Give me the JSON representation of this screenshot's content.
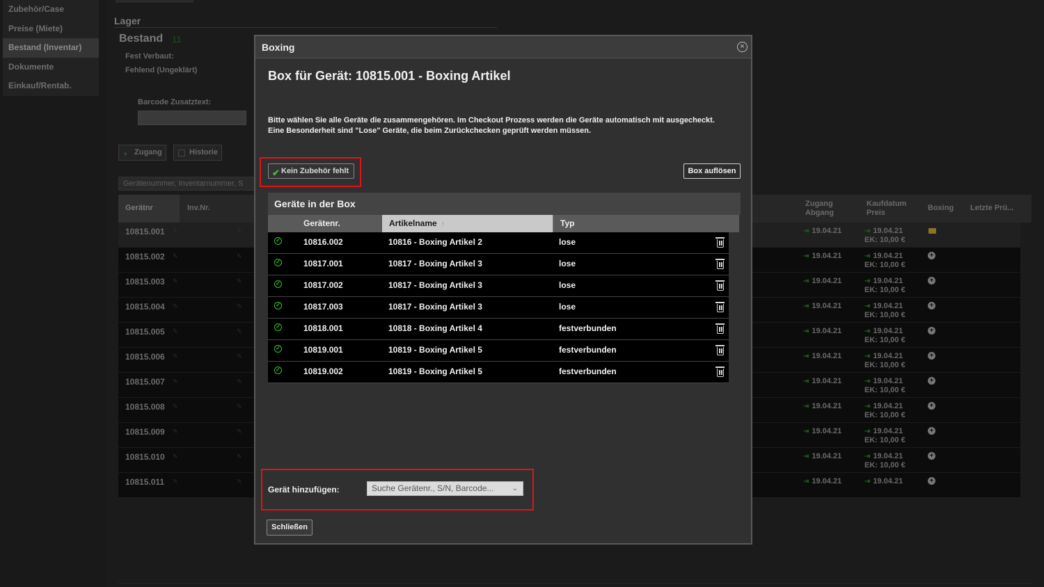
{
  "sidebar": {
    "items": [
      {
        "label": "Zubehör/Case",
        "active": false
      },
      {
        "label": "Preise (Miete)",
        "active": false
      },
      {
        "label": "Bestand (Inventar)",
        "active": true
      },
      {
        "label": "Dokumente",
        "active": false
      },
      {
        "label": "Einkauf/Rentab.",
        "active": false
      }
    ]
  },
  "main": {
    "section_title": "Lager",
    "bestand_title": "Bestand",
    "bestand_count": "11",
    "fest_verbaut_label": "Fest Verbaut:",
    "fehlend_label": "Fehlend (Ungeklärt)",
    "barcode_label": "Barcode Zusatztext:",
    "zugang_button": "Zugang",
    "historie_button": "Historie",
    "search_placeholder": "Gerätenummer, Inventarnummer, S",
    "table_headers": {
      "geraetnr": "Gerätnr",
      "inv_nr": "Inv.Nr.",
      "zugang_1": "Zugang",
      "zugang_2": "Abgang",
      "kaufdatum_1": "Kaufdatum",
      "kaufdatum_2": "Preis",
      "boxing": "Boxing",
      "letzte": "Letzte Prü..."
    },
    "rows": [
      {
        "nr": "10815.001",
        "zugang": "19.04.21",
        "kauf": "19.04.21",
        "ek": "EK: 10,00 €"
      },
      {
        "nr": "10815.002",
        "zugang": "19.04.21",
        "kauf": "19.04.21",
        "ek": "EK: 10,00 €"
      },
      {
        "nr": "10815.003",
        "zugang": "19.04.21",
        "kauf": "19.04.21",
        "ek": "EK: 10,00 €"
      },
      {
        "nr": "10815.004",
        "zugang": "19.04.21",
        "kauf": "19.04.21",
        "ek": "EK: 10,00 €"
      },
      {
        "nr": "10815.005",
        "zugang": "19.04.21",
        "kauf": "19.04.21",
        "ek": "EK: 10,00 €"
      },
      {
        "nr": "10815.006",
        "zugang": "19.04.21",
        "kauf": "19.04.21",
        "ek": "EK: 10,00 €"
      },
      {
        "nr": "10815.007",
        "zugang": "19.04.21",
        "kauf": "19.04.21",
        "ek": "EK: 10,00 €"
      },
      {
        "nr": "10815.008",
        "zugang": "19.04.21",
        "kauf": "19.04.21",
        "ek": "EK: 10,00 €"
      },
      {
        "nr": "10815.009",
        "zugang": "19.04.21",
        "kauf": "19.04.21",
        "ek": "EK: 10,00 €"
      },
      {
        "nr": "10815.010",
        "zugang": "19.04.21",
        "kauf": "19.04.21",
        "ek": "EK: 10,00 €"
      },
      {
        "nr": "10815.011",
        "zugang": "19.04.21",
        "kauf": "19.04.21",
        "ek": ""
      }
    ]
  },
  "dialog": {
    "title": "Boxing",
    "heading": "Box für Gerät: 10815.001 - Boxing Artikel",
    "info_line1": "Bitte wählen Sie alle Geräte die zusammengehören. Im Checkout Prozess werden die Geräte automatisch mit ausgecheckt.",
    "info_line2": "Eine Besonderheit sind \"Lose\" Geräte, die beim Zurückchecken geprüft werden müssen.",
    "kein_zubehoer_button": "Kein Zubehör fehlt",
    "box_aufloesen_button": "Box auflösen",
    "panel_title": "Geräte in der Box",
    "columns": {
      "geraetenr": "Gerätenr.",
      "artikelname": "Artikelname",
      "typ": "Typ"
    },
    "devices": [
      {
        "nr": "10816.002",
        "name": "10816 - Boxing Artikel 2",
        "typ": "lose"
      },
      {
        "nr": "10817.001",
        "name": "10817 - Boxing Artikel 3",
        "typ": "lose"
      },
      {
        "nr": "10817.002",
        "name": "10817 - Boxing Artikel 3",
        "typ": "lose"
      },
      {
        "nr": "10817.003",
        "name": "10817 - Boxing Artikel 3",
        "typ": "lose"
      },
      {
        "nr": "10818.001",
        "name": "10818 - Boxing Artikel 4",
        "typ": "festverbunden"
      },
      {
        "nr": "10819.001",
        "name": "10819 - Boxing Artikel 5",
        "typ": "festverbunden"
      },
      {
        "nr": "10819.002",
        "name": "10819 - Boxing Artikel 5",
        "typ": "festverbunden"
      }
    ],
    "add_label": "Gerät hinzufügen:",
    "add_placeholder": "Suche Gerätenr., S/N, Barcode...",
    "close_button": "Schließen"
  },
  "colors": {
    "highlight": "#e0141a",
    "ok_green": "#2ec52e",
    "case_icon": "#8a7520"
  }
}
